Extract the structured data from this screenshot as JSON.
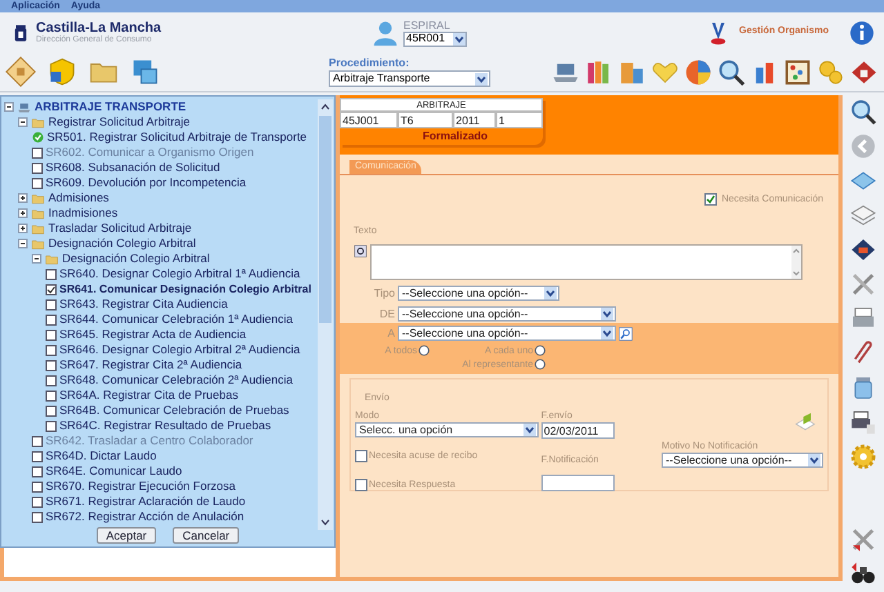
{
  "menu": [
    "Aplicación",
    "Ayuda"
  ],
  "header": {
    "org_name": "Castilla-La Mancha",
    "org_subtitle": "Dirección General de Consumo",
    "user_label": "ESPIRAL",
    "user_select": "45R001",
    "module": "Gestión Organismo"
  },
  "toolbar": {
    "procedure_label": "Procedimiento:",
    "procedure_select": "Arbitraje Transporte"
  },
  "tree": {
    "kind": "root",
    "label": "ARBITRAJE TRANSPORTE",
    "expanded": true,
    "children": [
      {
        "kind": "folder",
        "label": "Registrar Solicitud Arbitraje",
        "expanded": true,
        "children": [
          {
            "kind": "completed",
            "label": "SR501. Registrar Solicitud Arbitraje de Transporte"
          },
          {
            "kind": "task",
            "label": "SR602. Comunicar a Organismo Origen",
            "checked": false,
            "disabled": true,
            "selected": false
          },
          {
            "kind": "task",
            "label": "SR608. Subsanación de Solicitud",
            "checked": false,
            "disabled": false,
            "selected": false
          },
          {
            "kind": "task",
            "label": "SR609. Devolución por Incompetencia",
            "checked": false,
            "disabled": false,
            "selected": false
          }
        ]
      },
      {
        "kind": "folder",
        "label": "Admisiones",
        "expanded": false
      },
      {
        "kind": "folder",
        "label": "Inadmisiones",
        "expanded": false
      },
      {
        "kind": "folder",
        "label": "Trasladar Solicitud Arbitraje",
        "expanded": false
      },
      {
        "kind": "folder",
        "label": "Designación Colegio Arbitral",
        "expanded": true,
        "children": [
          {
            "kind": "folder",
            "label": "Designación Colegio Arbitral",
            "expanded": true,
            "children": [
              {
                "kind": "task",
                "label": "SR640. Designar Colegio Arbitral 1ª Audiencia",
                "checked": false,
                "disabled": false,
                "selected": false
              },
              {
                "kind": "task",
                "label": "SR641. Comunicar Designación Colegio Arbitral",
                "checked": true,
                "disabled": false,
                "selected": true
              },
              {
                "kind": "task",
                "label": "SR643. Registrar Cita Audiencia",
                "checked": false,
                "disabled": false,
                "selected": false
              },
              {
                "kind": "task",
                "label": "SR644. Comunicar Celebración 1ª Audiencia",
                "checked": false,
                "disabled": false,
                "selected": false
              },
              {
                "kind": "task",
                "label": "SR645. Registrar Acta de Audiencia",
                "checked": false,
                "disabled": false,
                "selected": false
              },
              {
                "kind": "task",
                "label": "SR646. Designar Colegio Arbitral 2ª Audiencia",
                "checked": false,
                "disabled": false,
                "selected": false
              },
              {
                "kind": "task",
                "label": "SR647. Registrar Cita 2ª Audiencia",
                "checked": false,
                "disabled": false,
                "selected": false
              },
              {
                "kind": "task",
                "label": "SR648. Comunicar Celebración 2ª Audiencia",
                "checked": false,
                "disabled": false,
                "selected": false
              },
              {
                "kind": "task",
                "label": "SR64A. Registrar Cita de Pruebas",
                "checked": false,
                "disabled": false,
                "selected": false
              },
              {
                "kind": "task",
                "label": "SR64B. Comunicar Celebración de Pruebas",
                "checked": false,
                "disabled": false,
                "selected": false
              },
              {
                "kind": "task",
                "label": "SR64C. Registrar Resultado de Pruebas",
                "checked": false,
                "disabled": false,
                "selected": false
              }
            ]
          },
          {
            "kind": "task",
            "label": "SR642. Trasladar a Centro Colaborador",
            "checked": false,
            "disabled": true,
            "selected": false
          },
          {
            "kind": "task",
            "label": "SR64D. Dictar Laudo",
            "checked": false,
            "disabled": false,
            "selected": false
          },
          {
            "kind": "task",
            "label": "SR64E. Comunicar Laudo",
            "checked": false,
            "disabled": false,
            "selected": false
          },
          {
            "kind": "task",
            "label": "SR670. Registrar Ejecución Forzosa",
            "checked": false,
            "disabled": false,
            "selected": false
          },
          {
            "kind": "task",
            "label": "SR671. Registrar Aclaración de Laudo",
            "checked": false,
            "disabled": false,
            "selected": false
          },
          {
            "kind": "task",
            "label": "SR672. Registrar Acción de Anulación",
            "checked": false,
            "disabled": false,
            "selected": false
          }
        ]
      }
    ]
  },
  "dialog_buttons": [
    "Aceptar",
    "Cancelar"
  ],
  "case_header": {
    "title": "ARBITRAJE",
    "cells": [
      "45J001",
      "T6",
      "2011",
      "1"
    ],
    "status": "Formalizado"
  },
  "tabs": [
    {
      "label": "Comunicación",
      "selected": true
    }
  ],
  "form": {
    "needs_communication": {
      "label": "Necesita Comunicación",
      "checked": true
    },
    "text_label": "Texto",
    "tipo": {
      "label": "Tipo",
      "value": "--Seleccione una opción--"
    },
    "de": {
      "label": "DE",
      "value": "--Seleccione una opción--"
    },
    "a": {
      "label": "A",
      "value": "--Seleccione una opción--"
    },
    "recipients": [
      {
        "label": "A todos",
        "selected": false
      },
      {
        "label": "A cada uno",
        "selected": false
      },
      {
        "label": "Al representante",
        "selected": false
      }
    ],
    "envio": {
      "legend": "Envío",
      "modo_label": "Modo",
      "modo_value": "Selecc. una opción",
      "fecha_envio_label": "F.envío",
      "fecha_envio": "02/03/2011",
      "fecha_notif_label": "F.Notificación",
      "motivo_label": "Motivo No Notificación",
      "motivo_value": "--Seleccione una opción--",
      "acuse": {
        "label": "Necesita acuse de recibo",
        "checked": false
      },
      "respuesta": {
        "label": "Necesita Respuesta",
        "checked": false
      }
    }
  }
}
